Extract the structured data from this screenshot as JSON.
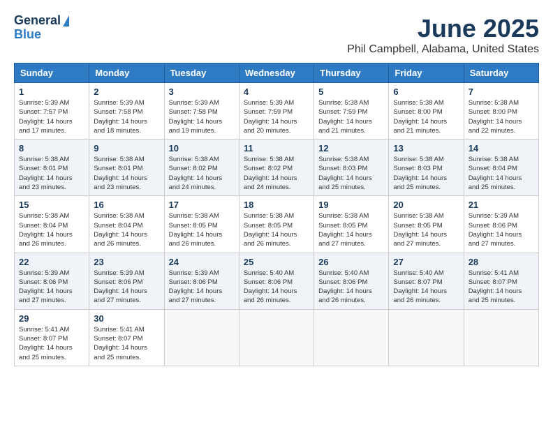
{
  "logo": {
    "line1": "General",
    "line2": "Blue"
  },
  "title": "June 2025",
  "location": "Phil Campbell, Alabama, United States",
  "weekdays": [
    "Sunday",
    "Monday",
    "Tuesday",
    "Wednesday",
    "Thursday",
    "Friday",
    "Saturday"
  ],
  "weeks": [
    [
      {
        "day": "1",
        "sunrise": "5:39 AM",
        "sunset": "7:57 PM",
        "daylight": "14 hours and 17 minutes."
      },
      {
        "day": "2",
        "sunrise": "5:39 AM",
        "sunset": "7:58 PM",
        "daylight": "14 hours and 18 minutes."
      },
      {
        "day": "3",
        "sunrise": "5:39 AM",
        "sunset": "7:58 PM",
        "daylight": "14 hours and 19 minutes."
      },
      {
        "day": "4",
        "sunrise": "5:39 AM",
        "sunset": "7:59 PM",
        "daylight": "14 hours and 20 minutes."
      },
      {
        "day": "5",
        "sunrise": "5:38 AM",
        "sunset": "7:59 PM",
        "daylight": "14 hours and 21 minutes."
      },
      {
        "day": "6",
        "sunrise": "5:38 AM",
        "sunset": "8:00 PM",
        "daylight": "14 hours and 21 minutes."
      },
      {
        "day": "7",
        "sunrise": "5:38 AM",
        "sunset": "8:00 PM",
        "daylight": "14 hours and 22 minutes."
      }
    ],
    [
      {
        "day": "8",
        "sunrise": "5:38 AM",
        "sunset": "8:01 PM",
        "daylight": "14 hours and 23 minutes."
      },
      {
        "day": "9",
        "sunrise": "5:38 AM",
        "sunset": "8:01 PM",
        "daylight": "14 hours and 23 minutes."
      },
      {
        "day": "10",
        "sunrise": "5:38 AM",
        "sunset": "8:02 PM",
        "daylight": "14 hours and 24 minutes."
      },
      {
        "day": "11",
        "sunrise": "5:38 AM",
        "sunset": "8:02 PM",
        "daylight": "14 hours and 24 minutes."
      },
      {
        "day": "12",
        "sunrise": "5:38 AM",
        "sunset": "8:03 PM",
        "daylight": "14 hours and 25 minutes."
      },
      {
        "day": "13",
        "sunrise": "5:38 AM",
        "sunset": "8:03 PM",
        "daylight": "14 hours and 25 minutes."
      },
      {
        "day": "14",
        "sunrise": "5:38 AM",
        "sunset": "8:04 PM",
        "daylight": "14 hours and 25 minutes."
      }
    ],
    [
      {
        "day": "15",
        "sunrise": "5:38 AM",
        "sunset": "8:04 PM",
        "daylight": "14 hours and 26 minutes."
      },
      {
        "day": "16",
        "sunrise": "5:38 AM",
        "sunset": "8:04 PM",
        "daylight": "14 hours and 26 minutes."
      },
      {
        "day": "17",
        "sunrise": "5:38 AM",
        "sunset": "8:05 PM",
        "daylight": "14 hours and 26 minutes."
      },
      {
        "day": "18",
        "sunrise": "5:38 AM",
        "sunset": "8:05 PM",
        "daylight": "14 hours and 26 minutes."
      },
      {
        "day": "19",
        "sunrise": "5:38 AM",
        "sunset": "8:05 PM",
        "daylight": "14 hours and 27 minutes."
      },
      {
        "day": "20",
        "sunrise": "5:38 AM",
        "sunset": "8:05 PM",
        "daylight": "14 hours and 27 minutes."
      },
      {
        "day": "21",
        "sunrise": "5:39 AM",
        "sunset": "8:06 PM",
        "daylight": "14 hours and 27 minutes."
      }
    ],
    [
      {
        "day": "22",
        "sunrise": "5:39 AM",
        "sunset": "8:06 PM",
        "daylight": "14 hours and 27 minutes."
      },
      {
        "day": "23",
        "sunrise": "5:39 AM",
        "sunset": "8:06 PM",
        "daylight": "14 hours and 27 minutes."
      },
      {
        "day": "24",
        "sunrise": "5:39 AM",
        "sunset": "8:06 PM",
        "daylight": "14 hours and 27 minutes."
      },
      {
        "day": "25",
        "sunrise": "5:40 AM",
        "sunset": "8:06 PM",
        "daylight": "14 hours and 26 minutes."
      },
      {
        "day": "26",
        "sunrise": "5:40 AM",
        "sunset": "8:06 PM",
        "daylight": "14 hours and 26 minutes."
      },
      {
        "day": "27",
        "sunrise": "5:40 AM",
        "sunset": "8:07 PM",
        "daylight": "14 hours and 26 minutes."
      },
      {
        "day": "28",
        "sunrise": "5:41 AM",
        "sunset": "8:07 PM",
        "daylight": "14 hours and 25 minutes."
      }
    ],
    [
      {
        "day": "29",
        "sunrise": "5:41 AM",
        "sunset": "8:07 PM",
        "daylight": "14 hours and 25 minutes."
      },
      {
        "day": "30",
        "sunrise": "5:41 AM",
        "sunset": "8:07 PM",
        "daylight": "14 hours and 25 minutes."
      },
      null,
      null,
      null,
      null,
      null
    ]
  ]
}
